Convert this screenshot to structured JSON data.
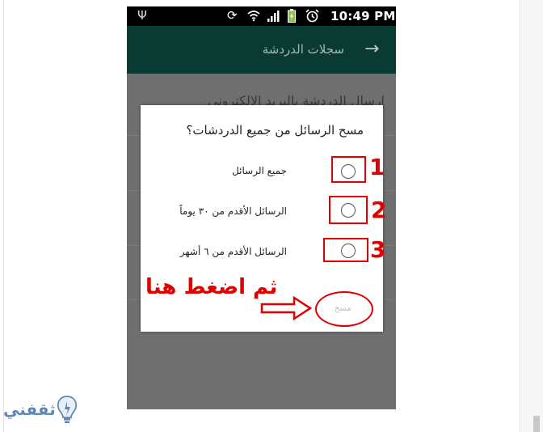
{
  "status_bar": {
    "time": "10:49 PM"
  },
  "app_bar": {
    "title": "سجلات الدردشة"
  },
  "background_item": {
    "label": "إرسال الدردشة بالبريد الالكتروني"
  },
  "dialog": {
    "title": "مسح الرسائل من جميع الدردشات؟",
    "options": [
      {
        "label": "جميع الرسائل",
        "number": "1"
      },
      {
        "label": "الرسائل الأقدم من ٣٠ يوماً",
        "number": "2"
      },
      {
        "label": "الرسائل الأقدم من ٦ أشهر",
        "number": "3"
      }
    ],
    "action_label": "مسح"
  },
  "annotation": {
    "instruction": "ثم اضغط هنا"
  },
  "logo": {
    "text": "ثقفني"
  },
  "colors": {
    "accent": "#e10000",
    "appbar": "#0a3b32",
    "dim_overlay": "#6f6f6f"
  }
}
